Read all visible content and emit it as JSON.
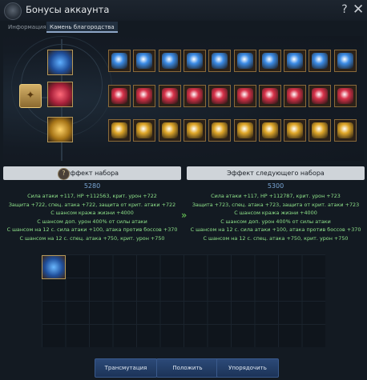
{
  "window": {
    "title": "Бонусы аккаунта",
    "help_icon": "?",
    "close_icon": "✕"
  },
  "tabs": [
    {
      "label": "Информация",
      "active": false
    },
    {
      "label": "Камень благородства",
      "active": true
    }
  ],
  "gem_rows": [
    {
      "color": "blue",
      "accent": "#3c8ce6",
      "count": 10
    },
    {
      "color": "red",
      "accent": "#d8324a",
      "count": 10
    },
    {
      "color": "gold",
      "accent": "#e0a82a",
      "count": 10
    }
  ],
  "set_effect": {
    "title": "Эффект набора",
    "count": "5280",
    "lines": [
      "Сила атаки +117, HP +112563, крит. урон +722",
      "Защита +722, спец. атака +722, защита от крит. атаки +722",
      "С шансом кража жизни +4000",
      "С шансом доп. урон 400% от силы атаки",
      "С шансом на 12 с. сила атаки +100, атака против боссов +370",
      "С шансом на 12 с. спец. атака +750, крит. урон +750"
    ]
  },
  "next_set_effect": {
    "title": "Эффект следующего набора",
    "count": "5300",
    "lines": [
      "Сила атаки +117, HP +112787, крит. урон +723",
      "Защита +723, спец. атака +723, защита от крит. атаки +723",
      "С шансом кража жизни +4000",
      "С шансом доп. урон 400% от силы атаки",
      "С шансом на 12 с. сила атаки +100, атака против боссов +370",
      "С шансом на 12 с. спец. атака +750, крит. урон +750"
    ]
  },
  "arrow": "»",
  "buttons": {
    "transmute": "Трансмутация",
    "place": "Положить",
    "sort": "Упорядочить"
  }
}
